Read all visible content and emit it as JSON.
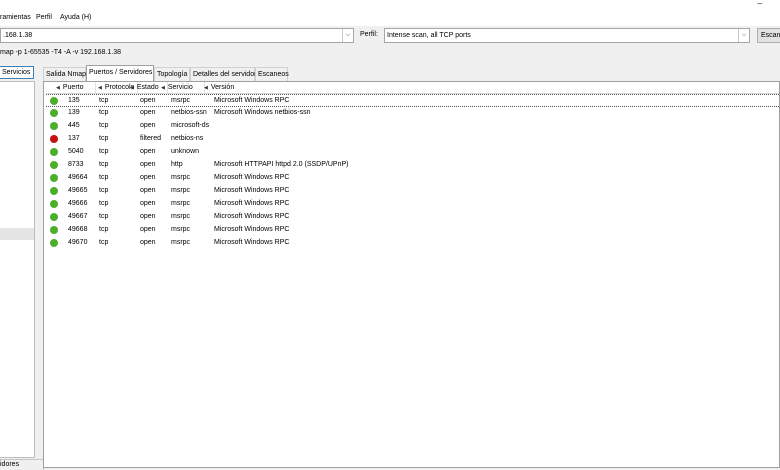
{
  "menu": {
    "items": [
      "ramientas",
      "Perfil",
      "Ayuda (H)"
    ],
    "window_minimize": "–"
  },
  "toolbar": {
    "target_value": ".168.1.38",
    "profile_label": "Perfil:",
    "profile_value": "Intense scan, all TCP ports",
    "scan_button": "Escanear",
    "dropdown_glyph": "⌵"
  },
  "command": {
    "text": "map -p 1-65535 -T4 -A -v 192.168.1.38"
  },
  "left": {
    "tab_label": "Servicios",
    "bottom_label": "idores"
  },
  "tabs": [
    {
      "label": "Salida Nmap",
      "active": false
    },
    {
      "label": "Puertos / Servidores",
      "active": true
    },
    {
      "label": "Topología",
      "active": false
    },
    {
      "label": "Detalles del servidor",
      "active": false
    },
    {
      "label": "Escaneos",
      "active": false
    }
  ],
  "table": {
    "headers": [
      "Puerto",
      "Protocolo",
      "Estado",
      "Servicio",
      "Versión"
    ],
    "sort_glyph": "◀",
    "rows": [
      {
        "port": "135",
        "protocol": "tcp",
        "state": "open",
        "service": "msrpc",
        "version": "Microsoft Windows RPC",
        "status": "open"
      },
      {
        "port": "139",
        "protocol": "tcp",
        "state": "open",
        "service": "netbios-ssn",
        "version": "Microsoft Windows netbios-ssn",
        "status": "open"
      },
      {
        "port": "445",
        "protocol": "tcp",
        "state": "open",
        "service": "microsoft-ds",
        "version": "",
        "status": "open"
      },
      {
        "port": "137",
        "protocol": "tcp",
        "state": "filtered",
        "service": "netbios-ns",
        "version": "",
        "status": "filtered"
      },
      {
        "port": "5040",
        "protocol": "tcp",
        "state": "open",
        "service": "unknown",
        "version": "",
        "status": "open"
      },
      {
        "port": "8733",
        "protocol": "tcp",
        "state": "open",
        "service": "http",
        "version": "Microsoft HTTPAPI httpd 2.0 (SSDP/UPnP)",
        "status": "open"
      },
      {
        "port": "49664",
        "protocol": "tcp",
        "state": "open",
        "service": "msrpc",
        "version": "Microsoft Windows RPC",
        "status": "open"
      },
      {
        "port": "49665",
        "protocol": "tcp",
        "state": "open",
        "service": "msrpc",
        "version": "Microsoft Windows RPC",
        "status": "open"
      },
      {
        "port": "49666",
        "protocol": "tcp",
        "state": "open",
        "service": "msrpc",
        "version": "Microsoft Windows RPC",
        "status": "open"
      },
      {
        "port": "49667",
        "protocol": "tcp",
        "state": "open",
        "service": "msrpc",
        "version": "Microsoft Windows RPC",
        "status": "open"
      },
      {
        "port": "49668",
        "protocol": "tcp",
        "state": "open",
        "service": "msrpc",
        "version": "Microsoft Windows RPC",
        "status": "open"
      },
      {
        "port": "49670",
        "protocol": "tcp",
        "state": "open",
        "service": "msrpc",
        "version": "Microsoft Windows RPC",
        "status": "open"
      }
    ]
  },
  "colors": {
    "open": "#4caf2a",
    "filtered": "#c81010",
    "accent": "#3c7fb1"
  }
}
